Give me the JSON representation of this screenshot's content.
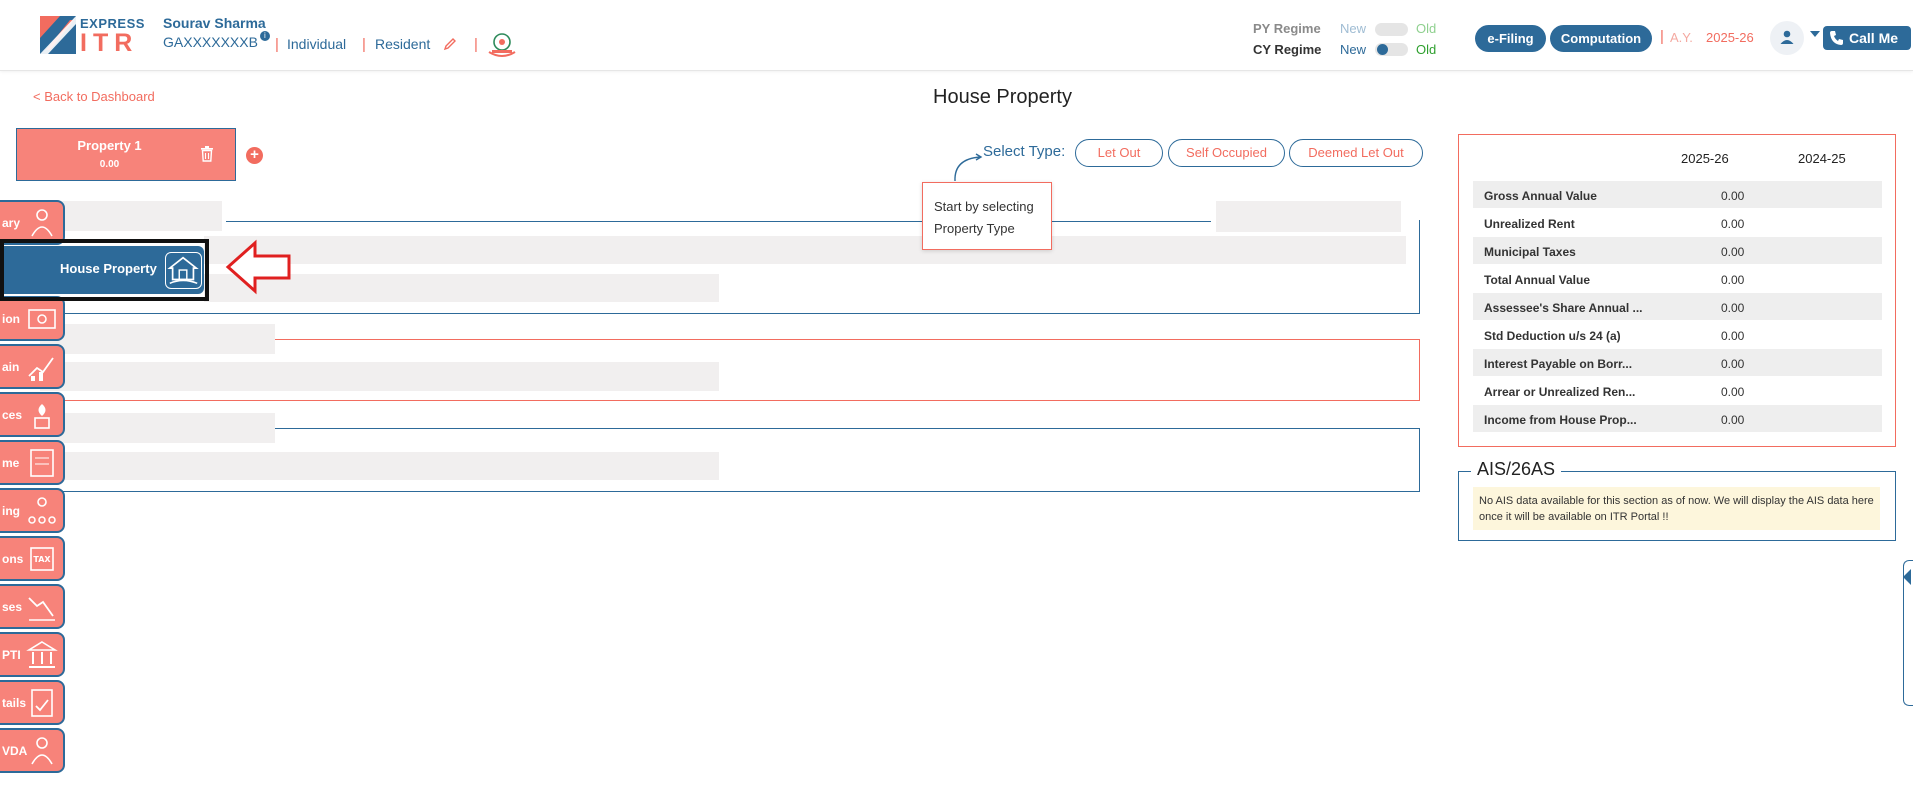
{
  "header": {
    "brand_top": "EXPRESS",
    "brand_bottom": "ITR",
    "user_name": "Sourav Sharma",
    "pan": "GAXXXXXXXB",
    "status": "Individual",
    "residency": "Resident",
    "py_regime_label": "PY Regime",
    "cy_regime_label": "CY Regime",
    "new_label": "New",
    "old_label": "Old",
    "efiling_label": "e-Filing",
    "computation_label": "Computation",
    "ay_label": "A.Y.",
    "ay_value": "2025-26",
    "call_label": "Call Me"
  },
  "page": {
    "back_label": "< Back to Dashboard",
    "title": "House Property"
  },
  "property": {
    "tab_label": "Property 1",
    "tab_amount": "0.00"
  },
  "select_type": {
    "label": "Select Type:",
    "options": [
      "Let Out",
      "Self Occupied",
      "Deemed Let Out"
    ]
  },
  "tooltip": {
    "line1": "Start by selecting",
    "line2": "Property Type"
  },
  "sidebar": {
    "active_label": "House Property",
    "items": [
      {
        "label": "ary",
        "icon": "summary-icon"
      },
      {
        "label": "ion",
        "icon": "salary-icon"
      },
      {
        "label": "ain",
        "icon": "capital-gain-icon"
      },
      {
        "label": "ces",
        "icon": "other-sources-icon"
      },
      {
        "label": "me",
        "icon": "tax-income-icon"
      },
      {
        "label": "ing",
        "icon": "business-icon"
      },
      {
        "label": "ons",
        "icon": "tax-deductions-icon"
      },
      {
        "label": "ses",
        "icon": "losses-icon"
      },
      {
        "label": "PTI",
        "icon": "pti-icon"
      },
      {
        "label": "tails",
        "icon": "tax-details-icon"
      },
      {
        "label": "VDA",
        "icon": "vda-icon"
      }
    ]
  },
  "summary": {
    "year_current": "2025-26",
    "year_previous": "2024-25",
    "rows": [
      {
        "label": "Gross Annual Value",
        "value": "0.00"
      },
      {
        "label": "Unrealized Rent",
        "value": "0.00"
      },
      {
        "label": "Municipal Taxes",
        "value": "0.00"
      },
      {
        "label": "Total Annual Value",
        "value": "0.00"
      },
      {
        "label": "Assessee's Share Annual ...",
        "value": "0.00"
      },
      {
        "label": "Std Deduction u/s 24 (a)",
        "value": "0.00"
      },
      {
        "label": "Interest Payable on Borr...",
        "value": "0.00"
      },
      {
        "label": "Arrear or Unrealized Ren...",
        "value": "0.00"
      },
      {
        "label": "Income from House Prop...",
        "value": "0.00"
      }
    ]
  },
  "ais": {
    "title": "AIS/26AS",
    "note": "No AIS data available for this section as of now. We will display the AIS data here once it will be available on ITR Portal !!"
  },
  "colors": {
    "primary": "#2d6a99",
    "accent": "#f26c5f",
    "accent_light": "#f7837a"
  }
}
